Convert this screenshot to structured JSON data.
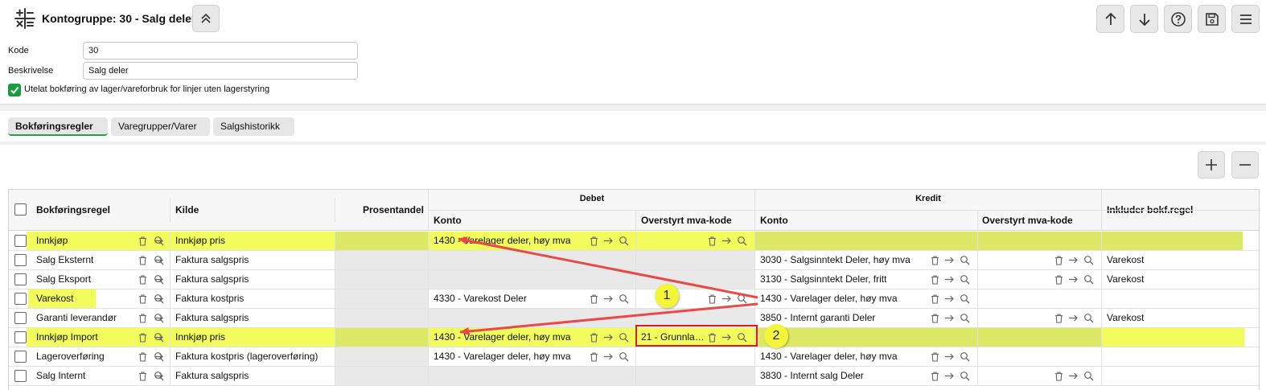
{
  "header": {
    "title": "Kontogruppe: 30 - Salg deler",
    "app_icon": "calculator-icon",
    "collapse_icon": "chevrons-up-icon",
    "tools": [
      {
        "name": "up-arrow-icon"
      },
      {
        "name": "down-arrow-icon"
      },
      {
        "name": "help-icon"
      },
      {
        "name": "save-icon"
      },
      {
        "name": "menu-icon"
      }
    ]
  },
  "form": {
    "kode_label": "Kode",
    "kode_value": "30",
    "beskrivelse_label": "Beskrivelse",
    "beskrivelse_value": "Salg deler",
    "checkbox_label": "Utelat bokføring av lager/vareforbruk for linjer uten lagerstyring",
    "checkbox_checked": true
  },
  "tabs": [
    {
      "label": "Bokføringsregler",
      "active": true
    },
    {
      "label": "Varegrupper/Varer",
      "active": false
    },
    {
      "label": "Salgshistorikk",
      "active": false
    }
  ],
  "grid": {
    "group_headers": {
      "debet": "Debet",
      "kredit": "Kredit"
    },
    "headers": {
      "regel": "Bokføringsregel",
      "kilde": "Kilde",
      "prosent": "Prosentandel",
      "debet_konto": "Konto",
      "debet_mva": "Overstyrt mva-kode",
      "kredit_konto": "Konto",
      "kredit_mva": "Overstyrt mva-kode",
      "inkluder": "Inkluder bokf.regel"
    },
    "rows": [
      {
        "regel": "Innkjøp",
        "kilde": "Innkjøp pris",
        "debet_konto": "1430 - Varelager deler, høy mva",
        "debet_mva": "",
        "kredit_konto": "",
        "kredit_mva": "",
        "inkluder": ""
      },
      {
        "regel": "Salg Eksternt",
        "kilde": "Faktura salgspris",
        "debet_konto": "",
        "debet_mva": "",
        "kredit_konto": "3030 - Salgsinntekt Deler, høy mva",
        "kredit_mva": "",
        "inkluder": "Varekost"
      },
      {
        "regel": "Salg Eksport",
        "kilde": "Faktura salgspris",
        "debet_konto": "",
        "debet_mva": "",
        "kredit_konto": "3130 - Salgsinntekt Deler, fritt",
        "kredit_mva": "",
        "inkluder": "Varekost"
      },
      {
        "regel": "Varekost",
        "kilde": "Faktura kostpris",
        "debet_konto": "4330 - Varekost Deler",
        "debet_mva": "",
        "kredit_konto": "1430 - Varelager deler, høy mva",
        "kredit_mva": "",
        "inkluder": ""
      },
      {
        "regel": "Garanti leverandør",
        "kilde": "Faktura salgspris",
        "debet_konto": "",
        "debet_mva": "",
        "kredit_konto": "3850 - Internt garanti Deler",
        "kredit_mva": "",
        "inkluder": "Varekost"
      },
      {
        "regel": "Innkjøp Import",
        "kilde": "Innkjøp pris",
        "debet_konto": "1430 - Varelager deler, høy mva",
        "debet_mva": "21 - Grunnla…",
        "kredit_konto": "",
        "kredit_mva": "",
        "inkluder": ""
      },
      {
        "regel": "Lageroverføring",
        "kilde": "Faktura kostpris (lageroverføring)",
        "debet_konto": "1430 - Varelager deler, høy mva",
        "debet_mva": "",
        "kredit_konto": "1430 - Varelager deler, høy mva",
        "kredit_mva": "",
        "inkluder": ""
      },
      {
        "regel": "Salg Internt",
        "kilde": "Faktura salgspris",
        "debet_konto": "",
        "debet_mva": "",
        "kredit_konto": "3830 - Internt salg Deler",
        "kredit_mva": "",
        "inkluder": ""
      }
    ]
  },
  "annotations": {
    "callout_1": "1",
    "callout_2": "2",
    "highlight_color": "#f2fb5c",
    "arrow_color": "#e84a4a"
  }
}
